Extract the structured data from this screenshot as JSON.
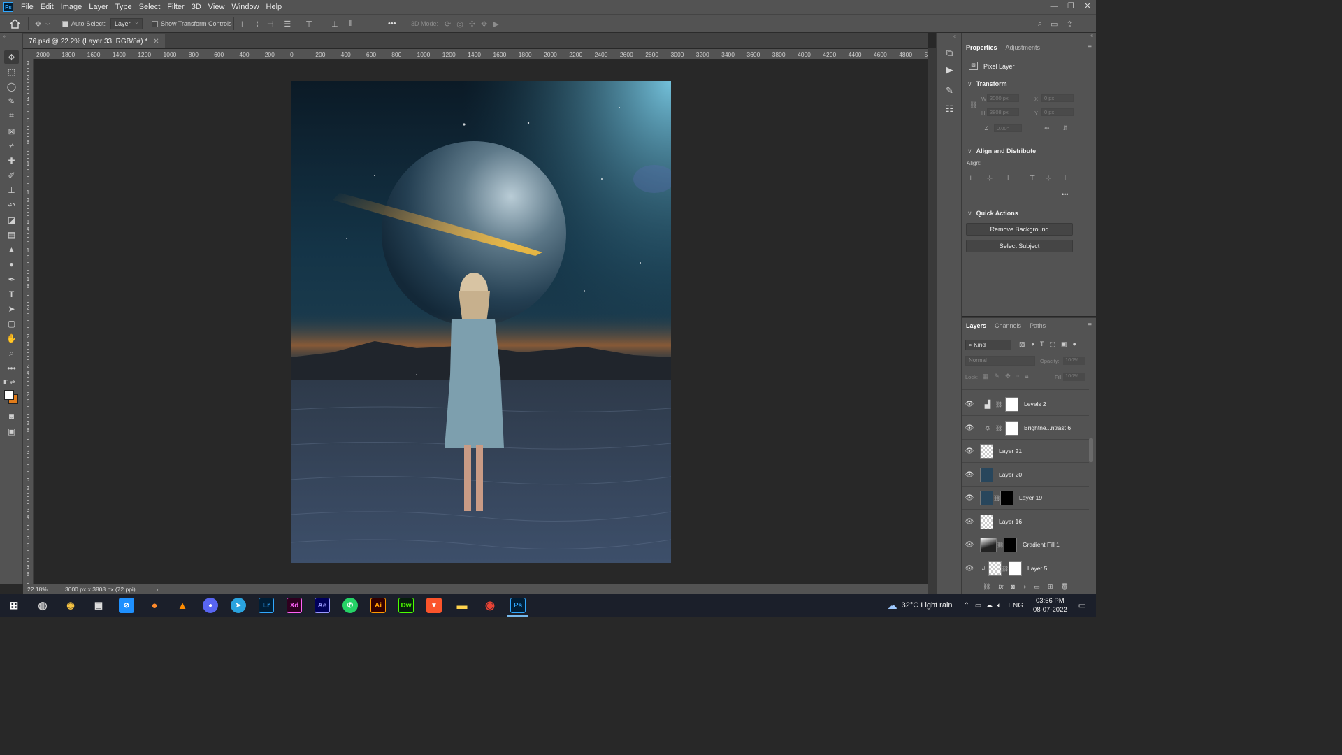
{
  "menubar": {
    "items": [
      "File",
      "Edit",
      "Image",
      "Layer",
      "Type",
      "Select",
      "Filter",
      "3D",
      "View",
      "Window",
      "Help"
    ]
  },
  "optionsbar": {
    "auto_select_label": "Auto-Select:",
    "auto_select_value": "Layer",
    "show_transform_label": "Show Transform Controls",
    "mode_label": "3D Mode:",
    "more": "•••"
  },
  "document": {
    "tab_title": "76.psd @ 22.2% (Layer 33, RGB/8#) *",
    "zoom": "22.18%",
    "doc_info": "3000 px x 3808 px (72 ppi)",
    "h_ruler": [
      "2000",
      "1800",
      "1600",
      "1400",
      "1200",
      "1000",
      "800",
      "600",
      "400",
      "200",
      "0",
      "200",
      "400",
      "600",
      "800",
      "1000",
      "1200",
      "1400",
      "1600",
      "1800",
      "2000",
      "2200",
      "2400",
      "2600",
      "2800",
      "3000",
      "3200",
      "3400",
      "3600",
      "3800",
      "4000",
      "4200",
      "4400",
      "4600",
      "4800",
      "5"
    ],
    "v_ruler": [
      "2",
      "0",
      "2",
      "0",
      "0",
      "4",
      "0",
      "0",
      "6",
      "0",
      "0",
      "8",
      "0",
      "0",
      "1",
      "0",
      "0",
      "0",
      "1",
      "2",
      "0",
      "0",
      "1",
      "4",
      "0",
      "0",
      "1",
      "6",
      "0",
      "0",
      "1",
      "8",
      "0",
      "0",
      "2",
      "0",
      "0",
      "0",
      "2",
      "2",
      "0",
      "0",
      "2",
      "4",
      "0",
      "0",
      "2",
      "6",
      "0",
      "0",
      "2",
      "8",
      "0",
      "0",
      "3",
      "0",
      "0",
      "0",
      "3",
      "2",
      "0",
      "0",
      "3",
      "4",
      "0",
      "0",
      "3",
      "6",
      "0",
      "0",
      "3",
      "8",
      "0",
      "0"
    ]
  },
  "properties": {
    "tabs": [
      "Properties",
      "Adjustments"
    ],
    "layer_type": "Pixel Layer",
    "transform_title": "Transform",
    "w_label": "W",
    "w_value": "3000 px",
    "h_label": "H",
    "h_value": "3808 px",
    "x_label": "X",
    "x_value": "0 px",
    "y_label": "Y",
    "y_value": "0 px",
    "angle_value": "0.00°",
    "align_title": "Align and Distribute",
    "align_label": "Align:",
    "quick_title": "Quick Actions",
    "remove_bg": "Remove Background",
    "select_subject": "Select Subject",
    "more": "•••"
  },
  "layers_panel": {
    "tabs": [
      "Layers",
      "Channels",
      "Paths"
    ],
    "filter_kind": "Kind",
    "blend_mode": "Normal",
    "opacity_label": "Opacity:",
    "opacity_value": "100%",
    "lock_label": "Lock:",
    "fill_label": "Fill:",
    "fill_value": "100%",
    "layers": [
      {
        "name": "Levels 2",
        "kind": "adjustment-levels"
      },
      {
        "name": "Brightne...ntrast 6",
        "kind": "adjustment-brightness"
      },
      {
        "name": "Layer 21",
        "kind": "pixel-transparent"
      },
      {
        "name": "Layer 20",
        "kind": "pixel-image"
      },
      {
        "name": "Layer 19",
        "kind": "pixel-image-mask"
      },
      {
        "name": "Layer 16",
        "kind": "pixel-transparent"
      },
      {
        "name": "Gradient Fill 1",
        "kind": "gradient-fill"
      },
      {
        "name": "Layer 5",
        "kind": "pixel-transparent-mask"
      }
    ]
  },
  "taskbar": {
    "apps": [
      "start",
      "chrome-alt",
      "cursor-app",
      "camera-app",
      "safari-like",
      "firefox",
      "vlc",
      "discord",
      "telegram",
      "Lr",
      "Xd",
      "Ae",
      "whatsapp",
      "Ai",
      "Dw",
      "brave",
      "file-explorer",
      "chrome",
      "Ps"
    ],
    "weather": "32°C  Light rain",
    "lang": "ENG",
    "time": "03:56 PM",
    "date": "08-07-2022"
  },
  "colors": {
    "accent": "#31a8ff",
    "panel_bg": "#535353",
    "canvas_bg": "#282828",
    "foreground_swatch": "#ffffff",
    "background_swatch": "#e07b1a"
  }
}
